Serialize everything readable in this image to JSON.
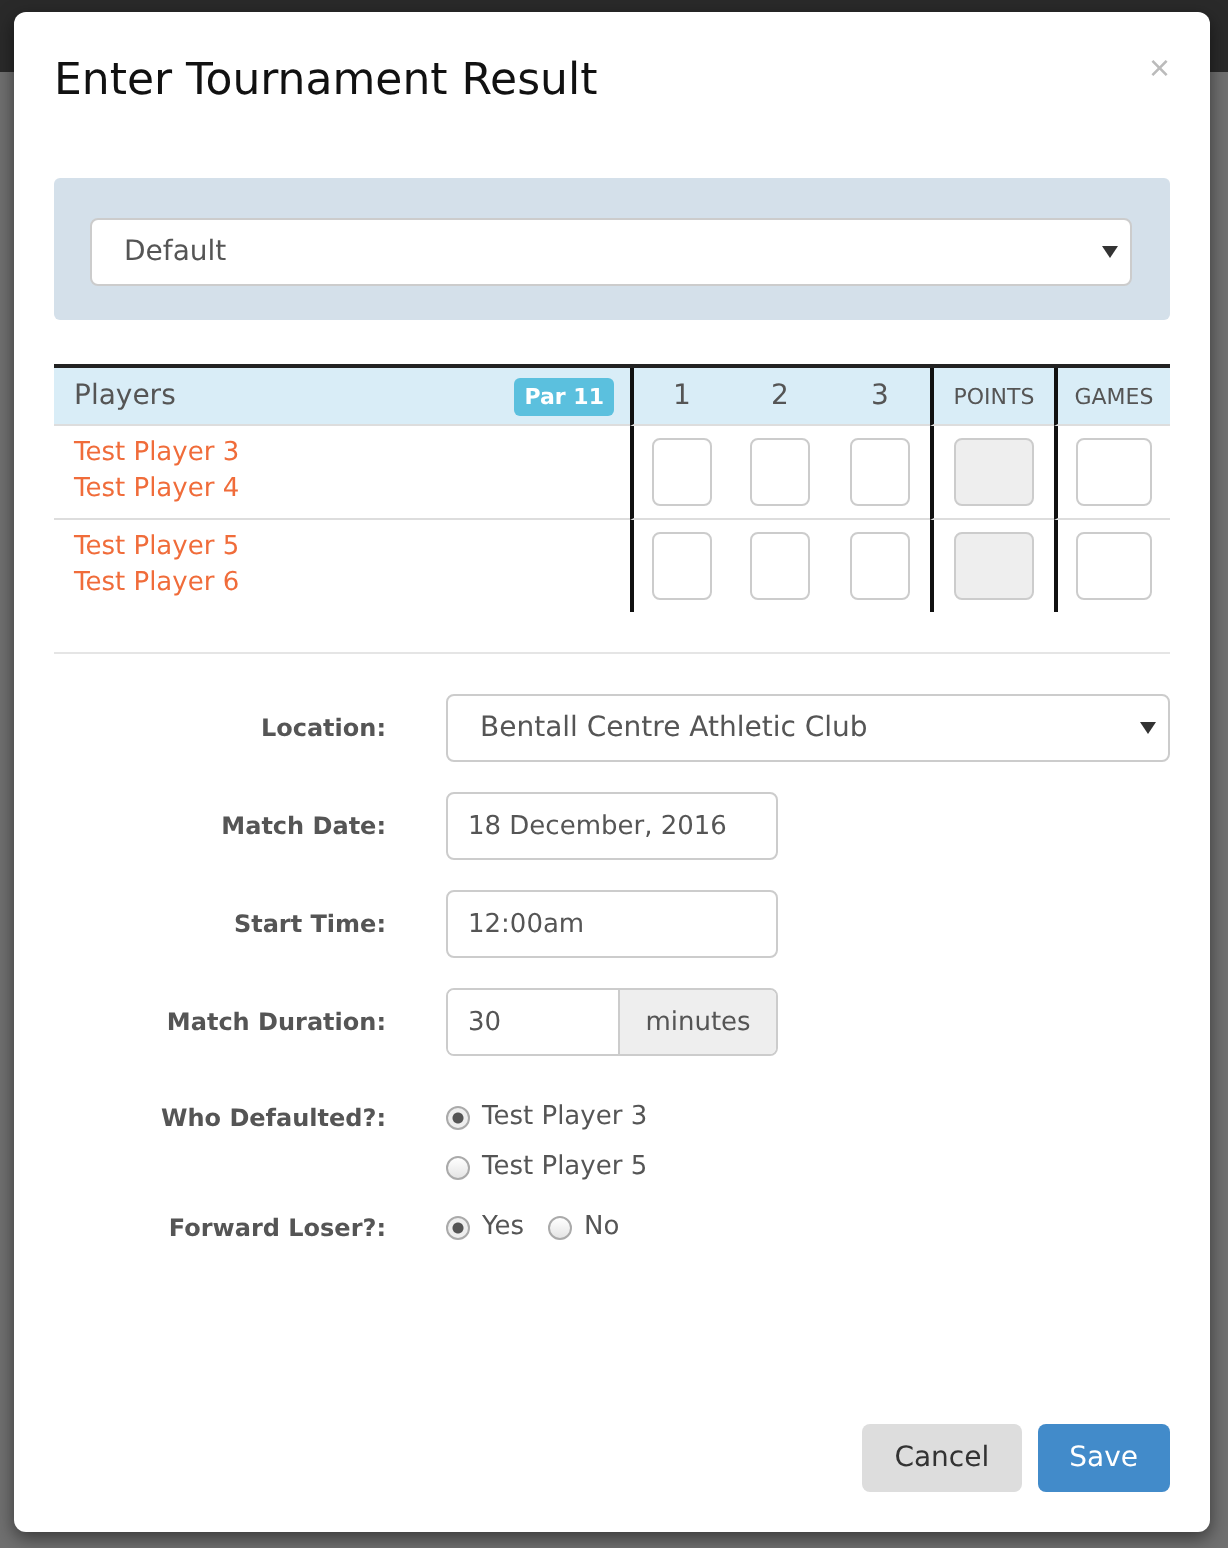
{
  "dialog": {
    "title": "Enter Tournament Result",
    "close": "×"
  },
  "format_select": {
    "value": "Default"
  },
  "score_table": {
    "players_label": "Players",
    "par_badge": "Par 11",
    "columns": [
      {
        "label": "1",
        "kind": "set",
        "disabled": false
      },
      {
        "label": "2",
        "kind": "set",
        "disabled": false
      },
      {
        "label": "3",
        "kind": "set",
        "disabled": false
      },
      {
        "label": "POINTS",
        "kind": "total",
        "disabled": true
      },
      {
        "label": "GAMES",
        "kind": "total",
        "disabled": false
      }
    ],
    "rows": [
      {
        "players": [
          "Test Player 3",
          "Test Player 4"
        ]
      },
      {
        "players": [
          "Test Player 5",
          "Test Player 6"
        ]
      }
    ]
  },
  "form": [
    {
      "kind": "select",
      "label": "Location:",
      "value": "Bentall Centre Athletic Club"
    },
    {
      "kind": "text",
      "label": "Match Date:",
      "value": "18 December, 2016"
    },
    {
      "kind": "text",
      "label": "Start Time:",
      "value": "12:00am"
    },
    {
      "kind": "addon",
      "label": "Match Duration:",
      "value": "30",
      "addon": "minutes"
    },
    {
      "kind": "radio-list",
      "label": "Who Defaulted?:",
      "options": [
        {
          "label": "Test Player 3",
          "selected": true
        },
        {
          "label": "Test Player 5",
          "selected": false
        }
      ]
    },
    {
      "kind": "radio-inline",
      "label": "Forward Loser?:",
      "options": [
        {
          "label": "Yes",
          "selected": true
        },
        {
          "label": "No",
          "selected": false
        }
      ]
    }
  ],
  "buttons": [
    {
      "label": "Cancel",
      "kind": "default"
    },
    {
      "label": "Save",
      "kind": "primary"
    }
  ]
}
